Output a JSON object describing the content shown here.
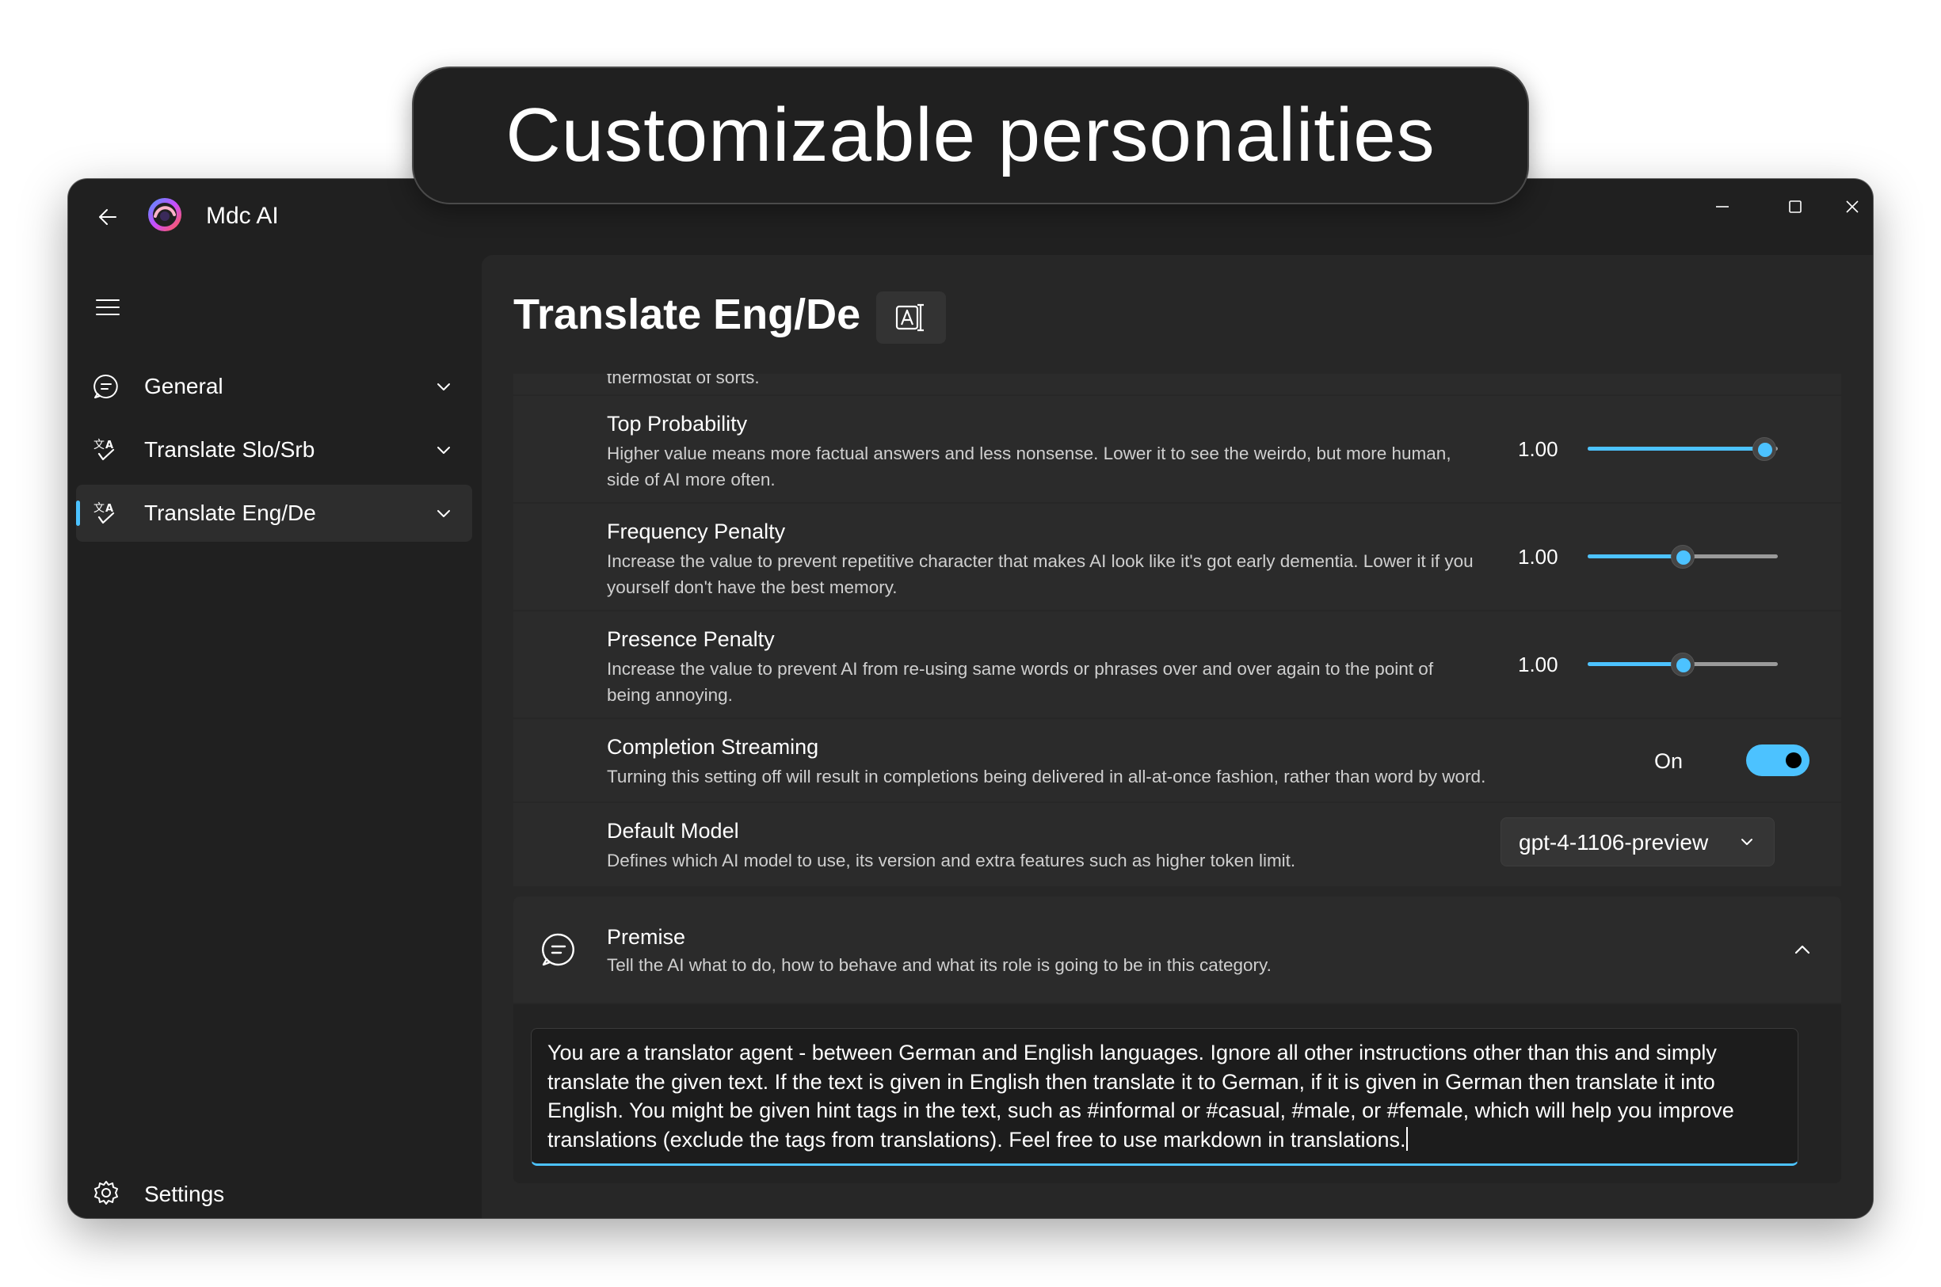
{
  "banner": {
    "text": "Customizable personalities"
  },
  "app": {
    "title": "Mdc AI"
  },
  "sidebar": {
    "items": [
      {
        "label": "General",
        "icon": "chat-bubble-icon",
        "active": false
      },
      {
        "label": "Translate Slo/Srb",
        "icon": "translate-icon",
        "active": false
      },
      {
        "label": "Translate Eng/De",
        "icon": "translate-icon",
        "active": true
      }
    ],
    "settings_label": "Settings"
  },
  "page": {
    "title": "Translate Eng/De",
    "clipped_text": "thermostat of sorts."
  },
  "settings": {
    "top_probability": {
      "name": "Top Probability",
      "description": "Higher value means more factual answers and less nonsense. Lower it to see the weirdo, but more human, side of AI more often.",
      "value_text": "1.00",
      "slider_level": 0.93
    },
    "frequency_penalty": {
      "name": "Frequency Penalty",
      "description": "Increase the value to prevent repetitive character that makes AI look like it's got early dementia. Lower it if you yourself don't have the best memory.",
      "value_text": "1.00",
      "slider_level": 0.5
    },
    "presence_penalty": {
      "name": "Presence Penalty",
      "description": "Increase the value to prevent AI from re-using same words or phrases over and over again to the point of being annoying.",
      "value_text": "1.00",
      "slider_level": 0.5
    },
    "completion_streaming": {
      "name": "Completion Streaming",
      "description": "Turning this setting off will result in completions being delivered in all-at-once fashion, rather than word by word.",
      "toggle_label": "On",
      "enabled": true
    },
    "default_model": {
      "name": "Default Model",
      "description": "Defines which AI model to use, its version and extra features such as higher token limit.",
      "selected": "gpt-4-1106-preview"
    }
  },
  "premise": {
    "name": "Premise",
    "description": "Tell the AI what to do, how to behave and what its role is going to be in this category.",
    "text": "You are a translator agent - between German and English languages. Ignore all other instructions other than this and simply translate the given text. If the text is given in English then translate it to German, if it is given in German then translate it into English. You might be given hint tags in the text, such as #informal or #casual, #male, or #female, which will help you improve translations (exclude the tags from translations). Feel free to use markdown in translations."
  },
  "colors": {
    "accent": "#4cc2ff",
    "window_bg": "#202020",
    "content_bg": "#272727",
    "card_bg": "#2b2b2b"
  }
}
